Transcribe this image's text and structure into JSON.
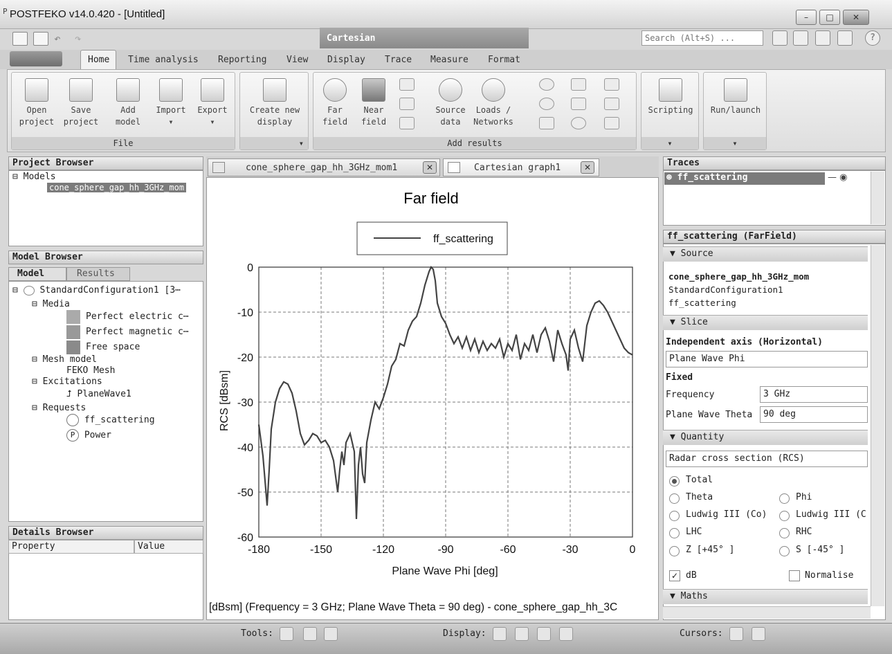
{
  "window": {
    "title": "POSTFEKO v14.0.420 - [Untitled]"
  },
  "context_tab": "Cartesian",
  "search": {
    "placeholder": "Search (Alt+S) ..."
  },
  "ribbon_tabs": [
    "Home",
    "Time analysis",
    "Reporting",
    "View",
    "Display",
    "Trace",
    "Measure",
    "Format"
  ],
  "ribbon": {
    "file": {
      "label": "File",
      "buttons": [
        "Open project",
        "Save project",
        "Add model",
        "Import",
        "Export"
      ]
    },
    "display": {
      "button": "Create new display"
    },
    "add_results": {
      "label": "Add results",
      "buttons": [
        "Far field",
        "Near field",
        "Source data",
        "Loads / Networks"
      ]
    },
    "scripting": "Scripting",
    "run": "Run/launch"
  },
  "project_browser": {
    "title": "Project Browser",
    "root": "Models",
    "model": "cone_sphere_gap_hh_3GHz_mom"
  },
  "model_browser": {
    "title": "Model Browser",
    "tabs": [
      "Model",
      "Results"
    ],
    "config": "StandardConfiguration1 [3⋯",
    "media": "Media",
    "media_items": [
      "Perfect electric c⋯",
      "Perfect magnetic c⋯",
      "Free space"
    ],
    "mesh_model": "Mesh model",
    "feko_mesh": "FEKO Mesh",
    "excitations": "Excitations",
    "planewave": "PlaneWave1",
    "requests": "Requests",
    "req_items": [
      "ff_scattering",
      "Power"
    ]
  },
  "details_browser": {
    "title": "Details Browser",
    "col_property": "Property",
    "col_value": "Value"
  },
  "doc_tabs": [
    "cone_sphere_gap_hh_3GHz_mom1",
    "Cartesian graph1"
  ],
  "graph": {
    "footer": "[dBsm] (Frequency = 3 GHz; Plane Wave Theta = 90 deg) - cone_sphere_gap_hh_3C"
  },
  "chart_data": {
    "type": "line",
    "title": "Far field",
    "xlabel": "Plane Wave Phi [deg]",
    "ylabel": "RCS [dBsm]",
    "xlim": [
      -180,
      0
    ],
    "ylim": [
      -60,
      0
    ],
    "xticks": [
      -180,
      -150,
      -120,
      -90,
      -60,
      -30,
      0
    ],
    "yticks": [
      0,
      -10,
      -20,
      -30,
      -40,
      -50,
      -60
    ],
    "grid": true,
    "legend": "top-center",
    "series": [
      {
        "name": "ff_scattering",
        "x": [
          -180,
          -178,
          -176,
          -175,
          -174,
          -172,
          -170,
          -168,
          -166,
          -164,
          -162,
          -160,
          -158,
          -156,
          -154,
          -152,
          -150,
          -148,
          -146,
          -144,
          -142,
          -141,
          -140,
          -139,
          -138,
          -136,
          -134,
          -133,
          -132,
          -131,
          -130,
          -129,
          -128,
          -126,
          -124,
          -122,
          -120,
          -118,
          -116,
          -114,
          -112,
          -110,
          -108,
          -106,
          -104,
          -102,
          -100,
          -98,
          -97,
          -96,
          -95,
          -94,
          -92,
          -90,
          -88,
          -86,
          -84,
          -82,
          -80,
          -78,
          -76,
          -74,
          -72,
          -70,
          -68,
          -66,
          -64,
          -62,
          -60,
          -58,
          -56,
          -54,
          -52,
          -50,
          -48,
          -46,
          -44,
          -42,
          -40,
          -38,
          -36,
          -34,
          -32,
          -31,
          -30,
          -28,
          -26,
          -24,
          -22,
          -20,
          -18,
          -16,
          -14,
          -12,
          -10,
          -8,
          -6,
          -4,
          -2,
          0
        ],
        "y": [
          -35,
          -42,
          -53,
          -45,
          -36,
          -30,
          -27,
          -25.5,
          -26,
          -28,
          -32,
          -37,
          -39.5,
          -38.5,
          -37,
          -37.5,
          -39,
          -38.5,
          -40,
          -43,
          -50,
          -45,
          -41,
          -44,
          -39,
          -37,
          -41,
          -56,
          -44,
          -40,
          -46,
          -48,
          -39,
          -34,
          -30,
          -31.5,
          -29,
          -26,
          -22,
          -20.5,
          -17,
          -17.5,
          -14,
          -12,
          -11,
          -8,
          -4,
          -1,
          0,
          -0.5,
          -3,
          -8,
          -11,
          -12.5,
          -15,
          -17,
          -15.5,
          -18,
          -15.5,
          -18.5,
          -16,
          -19,
          -16.5,
          -18.5,
          -17,
          -18,
          -16,
          -20,
          -17,
          -18.5,
          -15,
          -20.5,
          -17,
          -18.5,
          -15,
          -19,
          -15,
          -13.5,
          -16.5,
          -21,
          -14,
          -17,
          -19.5,
          -23,
          -16,
          -14,
          -18,
          -21,
          -13,
          -10,
          -8,
          -7.5,
          -8.5,
          -10,
          -12,
          -14,
          -16,
          -18,
          -19,
          -19.5
        ]
      }
    ]
  },
  "traces": {
    "title": "Traces",
    "items": [
      "ff_scattering"
    ]
  },
  "properties": {
    "title": "ff_scattering (FarField)",
    "source_header": "Source",
    "source_lines": [
      "cone_sphere_gap_hh_3GHz_mom",
      "StandardConfiguration1",
      "ff_scattering"
    ],
    "slice_header": "Slice",
    "independent_axis_label": "Independent axis (Horizontal)",
    "independent_axis_value": "Plane Wave Phi",
    "fixed_label": "Fixed",
    "frequency_label": "Frequency",
    "frequency_value": "3 GHz",
    "theta_label": "Plane Wave Theta",
    "theta_value": "90 deg",
    "quantity_header": "Quantity",
    "quantity_value": "Radar cross section (RCS)",
    "components": [
      "Total",
      "Theta",
      "Phi",
      "Ludwig III (Co)",
      "Ludwig III (C",
      "LHC",
      "RHC",
      "Z [+45° ]",
      "S [-45° ]"
    ],
    "selected_component": "Total",
    "db_label": "dB",
    "db_checked": true,
    "normalise_label": "Normalise",
    "maths_header": "Maths"
  },
  "statusbar": {
    "tools": "Tools:",
    "display": "Display:",
    "cursors": "Cursors:"
  }
}
